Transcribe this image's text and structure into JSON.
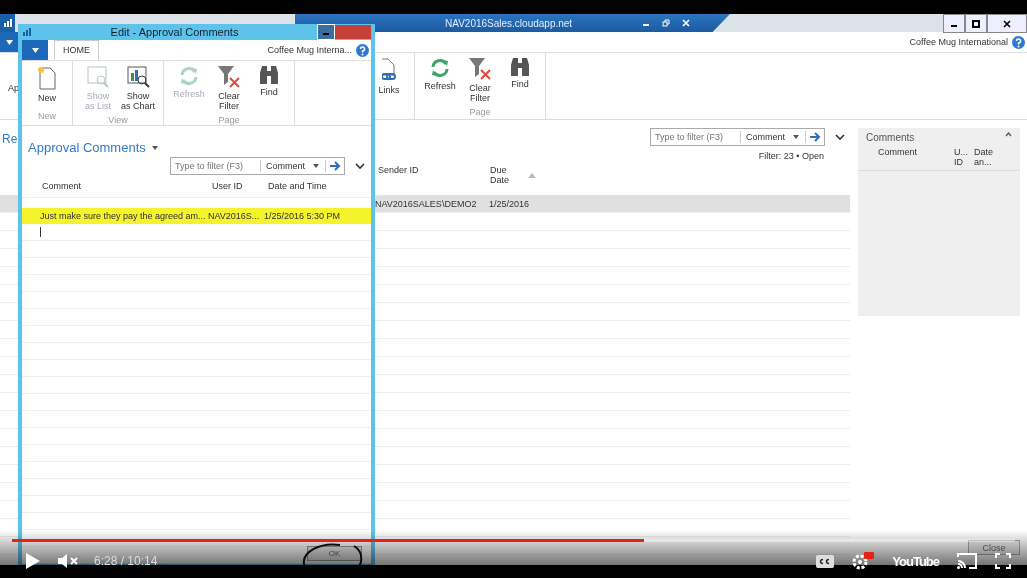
{
  "main_window": {
    "title": "NAV2016Sales.cloudapp.net",
    "company": "Coffee Mug International",
    "ribbon_cut_label": "Ap",
    "page_title_cut": "Re",
    "ribbon_groups": [
      {
        "actions": [
          {
            "label": "Links",
            "kind": "links",
            "disabled": false
          }
        ]
      },
      {
        "label": "Page",
        "actions": [
          {
            "label": "Refresh",
            "kind": "refresh",
            "disabled": false
          },
          {
            "label": "Clear Filter",
            "kind": "clear_filter",
            "disabled": false
          },
          {
            "label": "Find",
            "kind": "find",
            "disabled": false
          }
        ]
      }
    ],
    "filter": {
      "placeholder": "Type to filter (F3)",
      "field": "Comment"
    },
    "filter_status": "Filter: 23 • Open",
    "columns": [
      "Sender ID",
      "Due Date"
    ],
    "rows": [
      {
        "cells": [
          "NAV2016SALES\\DEMO2",
          "1/25/2016"
        ],
        "selected": true
      }
    ],
    "factbox": {
      "title": "Comments",
      "columns": [
        "Comment",
        "U... ID",
        "Date an..."
      ]
    },
    "close_button": "Close"
  },
  "dialog": {
    "title": "Edit - Approval Comments",
    "tab": {
      "label": "HOME",
      "selected": true
    },
    "company": "Coffee Mug Interna...",
    "ribbon_groups": [
      {
        "label": "New",
        "actions": [
          {
            "label": "New",
            "kind": "new",
            "disabled": false
          }
        ]
      },
      {
        "label": "View",
        "actions": [
          {
            "label": "Show as List",
            "kind": "list",
            "disabled": true
          },
          {
            "label": "Show as Chart",
            "kind": "chart",
            "disabled": false
          }
        ]
      },
      {
        "label": "Page",
        "actions": [
          {
            "label": "Refresh",
            "kind": "refresh",
            "disabled": true
          },
          {
            "label": "Clear Filter",
            "kind": "clear_filter",
            "disabled": false
          },
          {
            "label": "Find",
            "kind": "find",
            "disabled": false
          }
        ]
      }
    ],
    "list_title": "Approval Comments",
    "filter": {
      "placeholder": "Type to filter (F3)",
      "field": "Comment"
    },
    "columns": [
      "Comment",
      "User ID",
      "Date and Time"
    ],
    "rows": [
      {
        "cells": [
          "Just make sure they pay the agreed am...",
          "NAV2016S...",
          "1/25/2016 5:30 PM"
        ],
        "selected": true
      }
    ],
    "input_row": {
      "cursor": true
    },
    "ok_button": "OK"
  },
  "player": {
    "progress": {
      "level": 0.63
    },
    "time": "6:28 / 10:14",
    "muted": true,
    "logo": "YouTube"
  }
}
